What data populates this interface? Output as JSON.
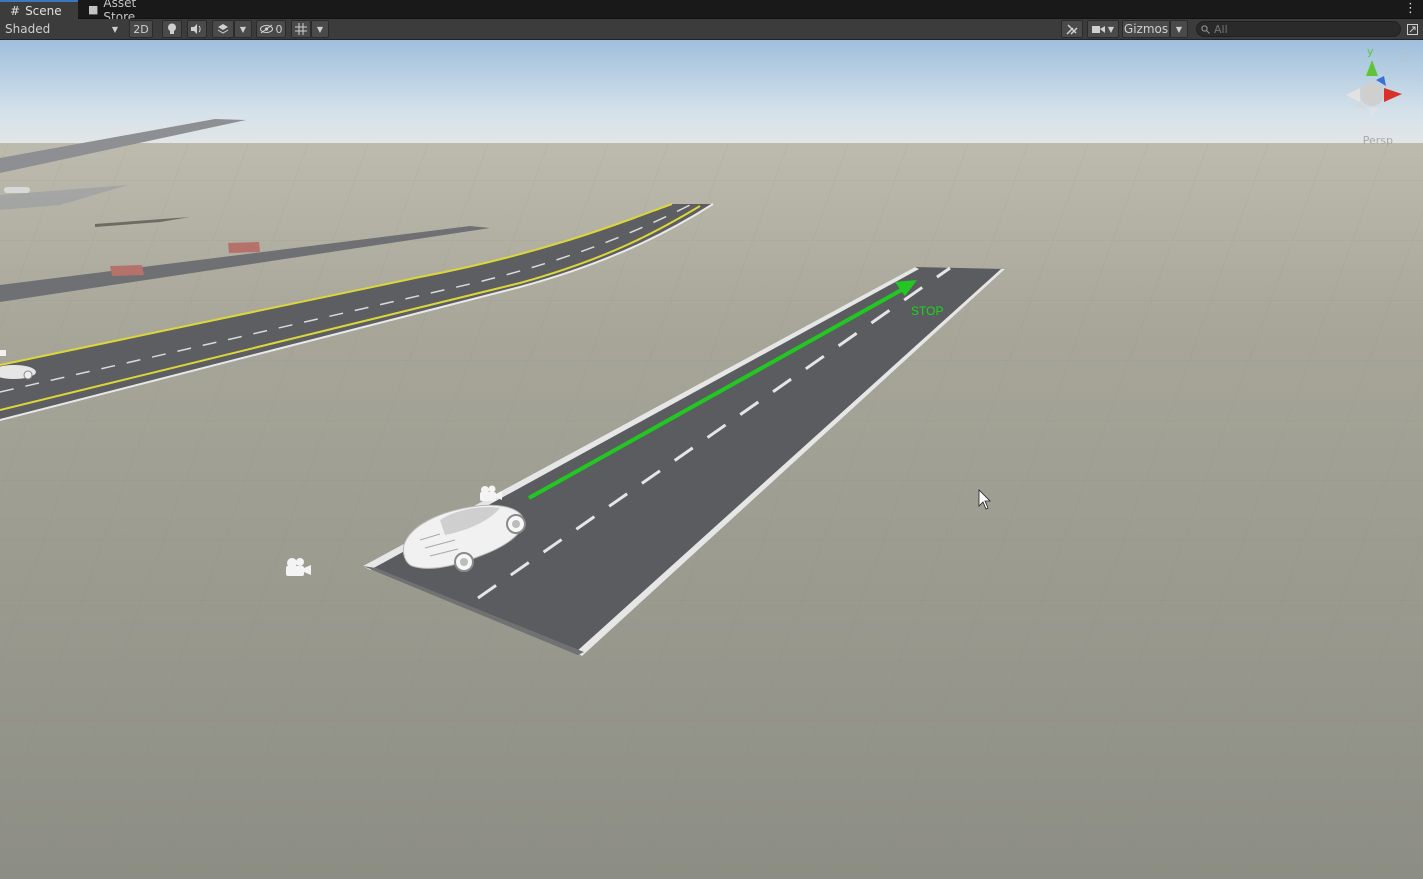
{
  "tabs": [
    {
      "label": "Scene",
      "icon": "grid-icon"
    },
    {
      "label": "Asset Store",
      "icon": "bag-icon"
    }
  ],
  "toolbar": {
    "shading_mode": "Shaded",
    "mode_2d_label": "2D",
    "hidden_count": "0",
    "gizmos_label": "Gizmos",
    "search_placeholder": "All"
  },
  "scene": {
    "projection_label": "Persp",
    "axis_y_label": "y",
    "waypoint_label": "STOP"
  },
  "colors": {
    "ground": "#8f8f84",
    "road": "#5a5a5c",
    "path_arrow": "#22c822",
    "gizmo_x": "#d8312a",
    "gizmo_y": "#5ec43a",
    "gizmo_z": "#3a6fd8"
  }
}
